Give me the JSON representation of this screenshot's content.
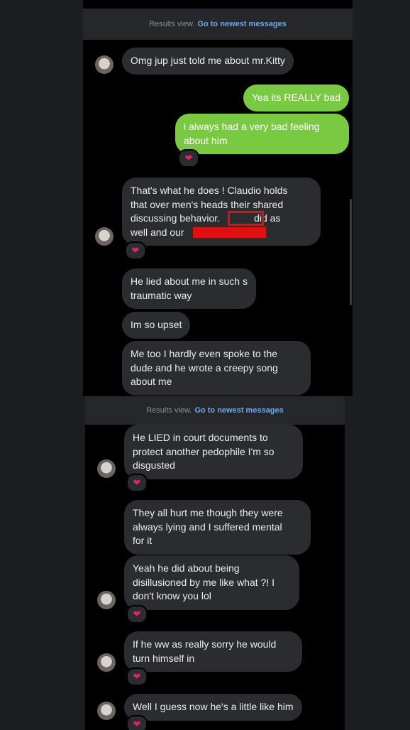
{
  "results_bar": {
    "prefix": "Results view.",
    "link": "Go to newest messages"
  },
  "messages": [
    {
      "id": "m1",
      "dir": "in",
      "lines": [
        "Omg jup just told me about mr.Kitty"
      ]
    },
    {
      "id": "m2",
      "dir": "out",
      "lines": [
        "Yea its REALLY bad"
      ]
    },
    {
      "id": "m3",
      "dir": "out",
      "lines": [
        "i always had a very bad feeling",
        "about him"
      ],
      "reaction": "❤"
    },
    {
      "id": "m4",
      "dir": "in",
      "lines": [
        "That's what he does ! Claudio holds",
        "that over men's heads their shared",
        "discussing behavior.",
        "did as",
        "well and our"
      ],
      "reaction": "❤"
    },
    {
      "id": "m5",
      "dir": "in",
      "lines": [
        "He lied about me in such s",
        "traumatic way"
      ]
    },
    {
      "id": "m6",
      "dir": "in",
      "lines": [
        "Im so upset"
      ]
    },
    {
      "id": "m7",
      "dir": "in",
      "lines": [
        "Me too I hardly even spoke to the",
        "dude and he wrote a creepy song",
        "about me"
      ]
    },
    {
      "id": "m8",
      "dir": "in",
      "lines": [
        "He LIED in court documents to",
        "protect another pedophile I'm so",
        "disgusted"
      ],
      "reaction": "❤"
    },
    {
      "id": "m9",
      "dir": "in",
      "lines": [
        "They all hurt me though they were",
        "always lying and I suffered mental",
        "for it"
      ]
    },
    {
      "id": "m10",
      "dir": "in",
      "lines": [
        "Yeah he did about being",
        "disillusioned by me like what ?! I",
        "don't know you lol"
      ],
      "reaction": "❤"
    },
    {
      "id": "m11",
      "dir": "in",
      "lines": [
        "If he ww as really sorry he would",
        "turn himself in"
      ],
      "reaction": "❤"
    },
    {
      "id": "m12",
      "dir": "in",
      "lines": [
        "Well I guess now he's a little like him"
      ],
      "reaction": "❤"
    }
  ],
  "colors": {
    "incoming_bubble": "#2b2c30",
    "outgoing_bubble": "#7ac943",
    "link": "#6fa8e8",
    "heart": "#e0245e",
    "redaction": "#e01010"
  },
  "icons": {
    "reaction": "heart-icon",
    "avatar": "avatar"
  }
}
